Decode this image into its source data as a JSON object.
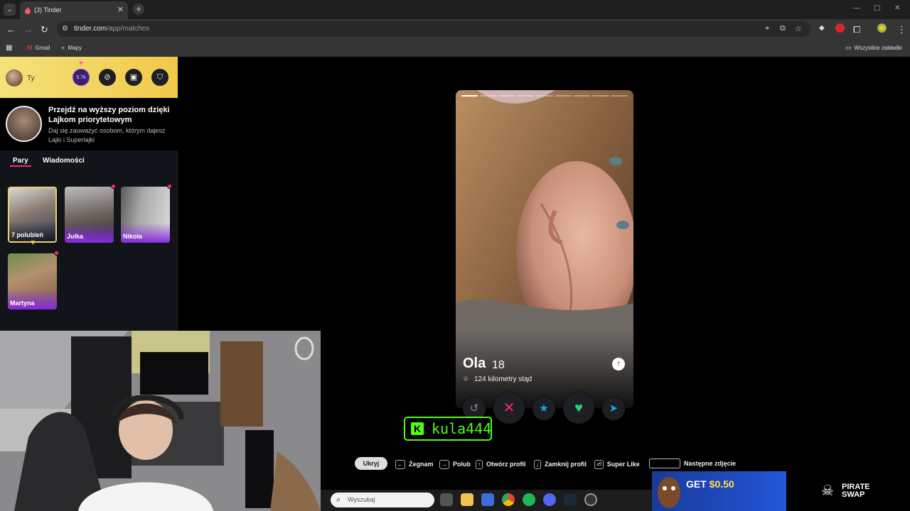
{
  "browser": {
    "tab_title": "(3) Tinder",
    "url_host": "tinder.com",
    "url_path": "/app/matches",
    "bookmarks": [
      "Gmail",
      "Mapy"
    ],
    "all_bookmarks": "Wszystkie zakładki"
  },
  "header": {
    "me_label": "Ty",
    "likes_count": "5.7k"
  },
  "promo": {
    "title": "Przejdź na wyższy poziom dzięki Lajkom priorytetowym",
    "subtitle": "Daj się zauważyć osobom, którym dajesz Lajki i Superlajki"
  },
  "tabs": {
    "pairs": "Pary",
    "messages": "Wiadomości"
  },
  "matches": [
    {
      "name": "7 polubień",
      "new": false
    },
    {
      "name": "Julka",
      "new": true
    },
    {
      "name": "Nikola",
      "new": true
    },
    {
      "name": "Martyna",
      "new": true
    }
  ],
  "profile": {
    "name": "Ola",
    "age": "18",
    "distance": "124 kilometry stąd",
    "photo_count": 9,
    "current_photo": 1
  },
  "overlay": {
    "channel": "kula444"
  },
  "hints": {
    "hide": "Ukryj",
    "nope": "Żegnam",
    "like": "Polub",
    "open": "Otwórz profil",
    "close": "Zamknij profil",
    "superlike": "Super Like",
    "next_photo": "Następne zdjęcie"
  },
  "taskbar": {
    "search_placeholder": "Wyszukaj"
  },
  "ad": {
    "get": "GET",
    "price": "$0.50",
    "brand_line1": "PIRATE",
    "brand_line2": "SWAP"
  },
  "colors": {
    "tinder_pink": "#fd267a",
    "kick_green": "#53fc18",
    "gold": "#f0c94a"
  }
}
